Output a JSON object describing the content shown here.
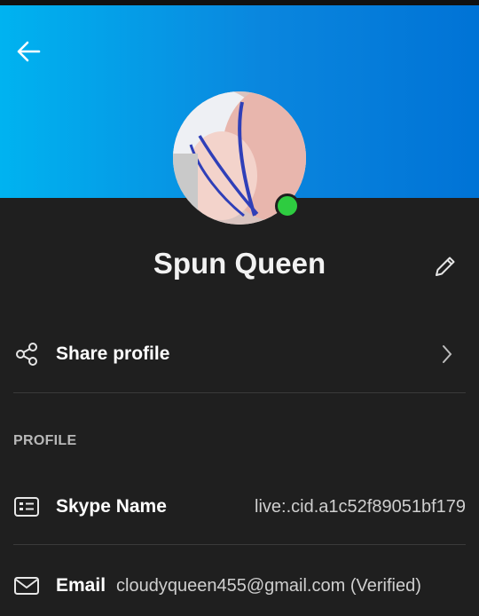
{
  "header": {
    "back_icon": "arrow-left-icon",
    "gradient_colors": [
      "#00b3f0",
      "#0073d6"
    ]
  },
  "profile": {
    "display_name": "Spun Queen",
    "presence_color": "#2ecc40",
    "edit_icon": "pencil-icon"
  },
  "actions": {
    "share_label": "Share profile",
    "share_icon": "share-icon",
    "chevron_icon": "chevron-right-icon"
  },
  "section_title": "PROFILE",
  "fields": {
    "skype_name_label": "Skype Name",
    "skype_name_value": "live:.cid.a1c52f89051bf179",
    "skype_icon": "id-card-icon",
    "email_label": "Email",
    "email_value": "cloudyqueen455@gmail.com (Verified)",
    "email_icon": "envelope-icon"
  }
}
